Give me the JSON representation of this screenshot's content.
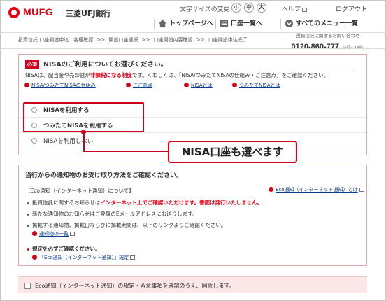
{
  "header": {
    "logo": "MUFG",
    "bank_name": "三菱UFJ銀行",
    "font_size_label": "文字サイズの変更",
    "font_sizes": [
      "小",
      "中",
      "大"
    ],
    "help": "ヘルプ",
    "logout": "ログアウト",
    "nav": [
      "トップページへ",
      "口座一覧へ",
      "すべてのメニュー一覧"
    ]
  },
  "breadcrumb": [
    "投資信託 口座開設申込｜各種確認",
    "開設口座選択",
    "口座開設内容確認",
    "口座開設申込完了"
  ],
  "breadcrumb_sep": ">>",
  "contact": {
    "label": "投資信託に関するお問い合わせ",
    "number": "0120-860-777",
    "hours": "(9時〜18時)"
  },
  "nisa_section": {
    "badge": "必須",
    "title": "NISAのご利用についてお選びください。",
    "desc_before": "NISAは、配当金や売却益が",
    "desc_red": "非課税になる制度",
    "desc_after": "です。くわしくは、「NISA/つみたてNISAの仕組み・ご注意点」をご確認ください。",
    "links": [
      "NISA/つみたてNISAの仕組み",
      "ご注意点",
      "NISAとは",
      "つみたてNISAとは"
    ],
    "options": [
      "NISAを利用する",
      "つみたてNISAを利用する",
      "NISAを利用しない"
    ]
  },
  "callout": "NISA口座も選べます",
  "notice_section": {
    "title": "当行からの通知物のお受け取り方法をご確認ください。",
    "subtitle": "【Eco通知（インターネット通知）について】",
    "right_link": "Eco通知（インターネット通知）とは",
    "bullets": [
      {
        "before": "投資信託に関するお知らせは",
        "red": "インターネット上でご確認いただけます。書面は発行いたしません。",
        "after": ""
      },
      {
        "before": "新たな通知物のお知らせはご登録のEメールアドレスにお送りします。",
        "red": "",
        "after": ""
      },
      {
        "before": "掲載する通知物、掲載日ならびに掲載期間は、以下のリンクよりご確認ください。",
        "red": "",
        "after": ""
      }
    ],
    "list_link": "通知物の一覧",
    "must_confirm": "規定を必ずご確認ください。",
    "rule_link": "「Eco通知（インターネット通知）」規定"
  },
  "agree": {
    "label": "Eco通知（インターネット通知）の規定・留意事項を確認のうえ、同意します。",
    "checked": false
  },
  "colors": {
    "brand_red": "#e60012",
    "link_blue": "#0a3d91",
    "section_border": "#e2a9a9",
    "agree_bg": "#fbe7e7"
  }
}
